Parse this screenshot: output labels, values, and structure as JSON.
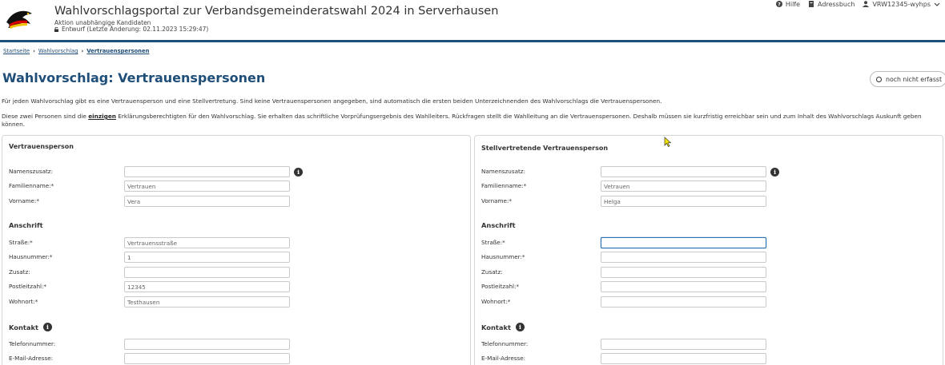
{
  "header": {
    "title": "Wahlvorschlagsportal zur Verbandsgemeinderatswahl 2024 in Serverhausen",
    "subtitle": "Aktion unabhängige Kandidaten",
    "draft_status": "Entwurf (Letzte Änderung: 02.11.2023 15:29:47)",
    "nav": {
      "help": "Hilfe",
      "addressbook": "Adressbuch",
      "user": "VRW12345-wyhps"
    }
  },
  "breadcrumb": [
    "Startseite",
    "Wahlvorschlag",
    "Vertrauenspersonen"
  ],
  "page": {
    "title": "Wahlvorschlag: Vertrauenspersonen",
    "status": "noch nicht erfasst",
    "intro1": "Für jeden Wahlvorschlag gibt es eine Vertrauensperson und eine Stellvertretung. Sind keine Vertrauenspersonen angegeben, sind automatisch die ersten beiden Unterzeichnenden des Wahlvorschlags die Vertrauenspersonen.",
    "intro2_a": "Diese zwei Personen sind die ",
    "intro2_em": "einzigen",
    "intro2_b": " Erklärungsberechtigten für den Wahlvorschlag. Sie erhalten das schriftliche Vorprüfungsergebnis des Wahlleiters. Rückfragen stellt die Wahlleitung an die Vertrauenspersonen. Deshalb müssen sie kurzfristig erreichbar sein und zum Inhalt des Wahlvorschlags Auskunft geben können."
  },
  "labels": {
    "namenszusatz": "Namenszusatz:",
    "familienname": "Familienname:*",
    "vorname": "Vorname:*",
    "anschrift": "Anschrift",
    "strasse": "Straße:*",
    "hausnummer": "Hausnummer:*",
    "zusatz": "Zusatz:",
    "plz": "Postleitzahl:*",
    "wohnort": "Wohnort:*",
    "kontakt": "Kontakt",
    "telefon": "Telefonnummer:",
    "email": "E-Mail-Adresse:"
  },
  "left": {
    "title": "Vertrauensperson",
    "namenszusatz": "",
    "familienname": "Vertrauen",
    "vorname": "Vera",
    "strasse": "Vertrauensstraße",
    "hausnummer": "1",
    "zusatz": "",
    "plz": "12345",
    "wohnort": "Testhausen",
    "telefon": "",
    "email": ""
  },
  "right": {
    "title": "Stellvertretende Vertrauensperson",
    "namenszusatz": "",
    "familienname": "Vetrauen",
    "vorname": "Helga",
    "strasse": "",
    "hausnummer": "",
    "zusatz": "",
    "plz": "",
    "wohnort": "",
    "telefon": "",
    "email": ""
  },
  "colors": {
    "brand": "#1f4e79",
    "focus": "#2a6fb0"
  },
  "icons": [
    "eagle-logo-icon",
    "help-icon",
    "addressbook-icon",
    "user-icon",
    "chevron-down-icon",
    "unlock-icon",
    "info-icon"
  ]
}
